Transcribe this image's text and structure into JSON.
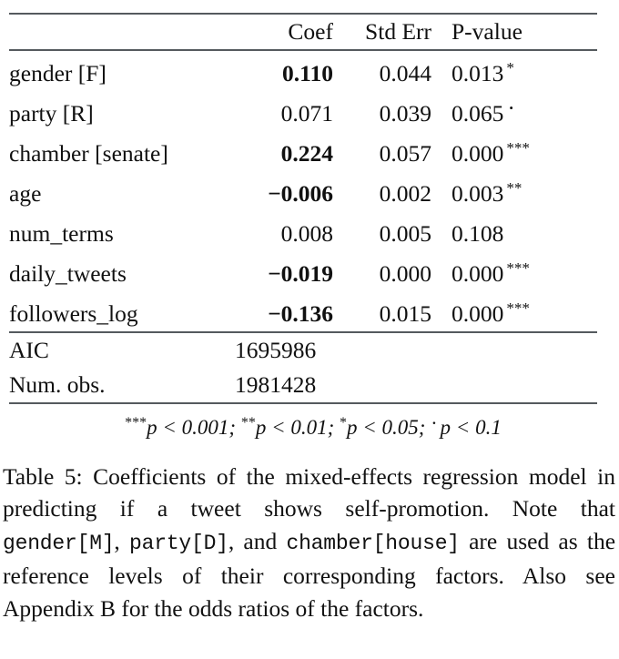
{
  "table": {
    "number_label": "Table 5",
    "columns": [
      "",
      "Coef",
      "Std Err",
      "P-value"
    ],
    "rows": [
      {
        "label": "gender [F]",
        "coef": "0.110",
        "coef_bold": true,
        "std_err": "0.044",
        "p_value": "0.013",
        "sig": "*"
      },
      {
        "label": "party [R]",
        "coef": "0.071",
        "coef_bold": false,
        "std_err": "0.039",
        "p_value": "0.065",
        "sig": "·"
      },
      {
        "label": "chamber [senate]",
        "coef": "0.224",
        "coef_bold": true,
        "std_err": "0.057",
        "p_value": "0.000",
        "sig": "***"
      },
      {
        "label": "age",
        "coef": "−0.006",
        "coef_bold": true,
        "std_err": "0.002",
        "p_value": "0.003",
        "sig": "**"
      },
      {
        "label": "num_terms",
        "coef": "0.008",
        "coef_bold": false,
        "std_err": "0.005",
        "p_value": "0.108",
        "sig": ""
      },
      {
        "label": "daily_tweets",
        "coef": "−0.019",
        "coef_bold": true,
        "std_err": "0.000",
        "p_value": "0.000",
        "sig": "***"
      },
      {
        "label": "followers_log",
        "coef": "−0.136",
        "coef_bold": true,
        "std_err": "0.015",
        "p_value": "0.000",
        "sig": "***"
      }
    ],
    "fit_rows": [
      {
        "label": "AIC",
        "value": "1695986"
      },
      {
        "label": "Num. obs.",
        "value": "1981428"
      }
    ],
    "footnote": {
      "s1_stars": "***",
      "s1_text": "p < 0.001;",
      "s2_stars": "**",
      "s2_text": "p < 0.01;",
      "s3_stars": "*",
      "s3_text": "p < 0.05;",
      "s4_dot": "·",
      "s4_text": "p < 0.1"
    },
    "rule_color": "#555a5e"
  },
  "caption": {
    "prefix": "Table 5:",
    "part1": " Coefficients of the mixed-effects regression model in predicting if a tweet shows self-promotion. Note that ",
    "mono1": "gender[M]",
    "sep1": ", ",
    "mono2": "party[D]",
    "sep2": ", and ",
    "mono3": "chamber[house]",
    "part2": " are used as the reference levels of their corresponding factors. Also see Appendix B for the odds ratios of the factors."
  }
}
